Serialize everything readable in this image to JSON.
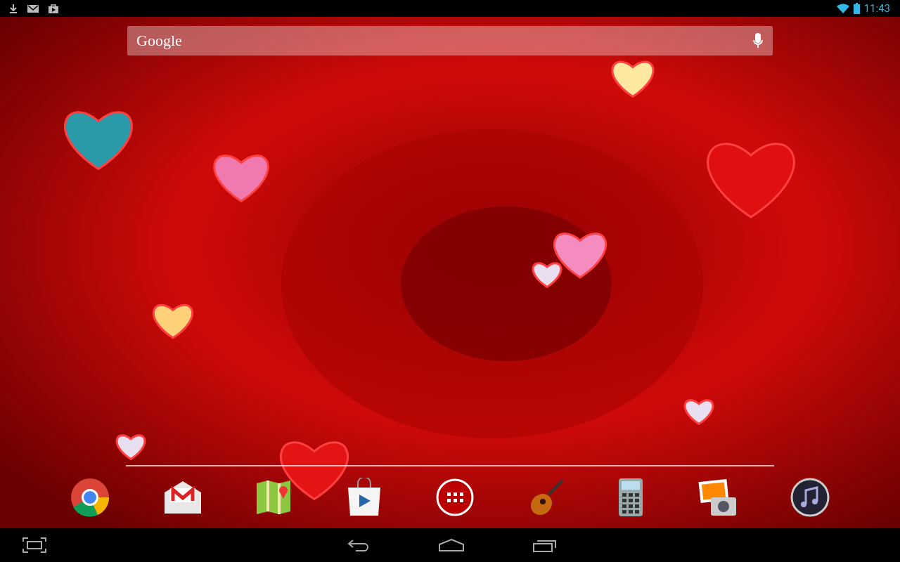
{
  "status_bar": {
    "time": "11:43"
  },
  "search_bar": {
    "label": "Google"
  },
  "dock": [
    {
      "kind": "browser"
    },
    {
      "kind": "mail"
    },
    {
      "kind": "maps"
    },
    {
      "kind": "store"
    },
    {
      "kind": "apps"
    },
    {
      "kind": "guitar"
    },
    {
      "kind": "calculator"
    },
    {
      "kind": "photos"
    },
    {
      "kind": "music"
    }
  ]
}
